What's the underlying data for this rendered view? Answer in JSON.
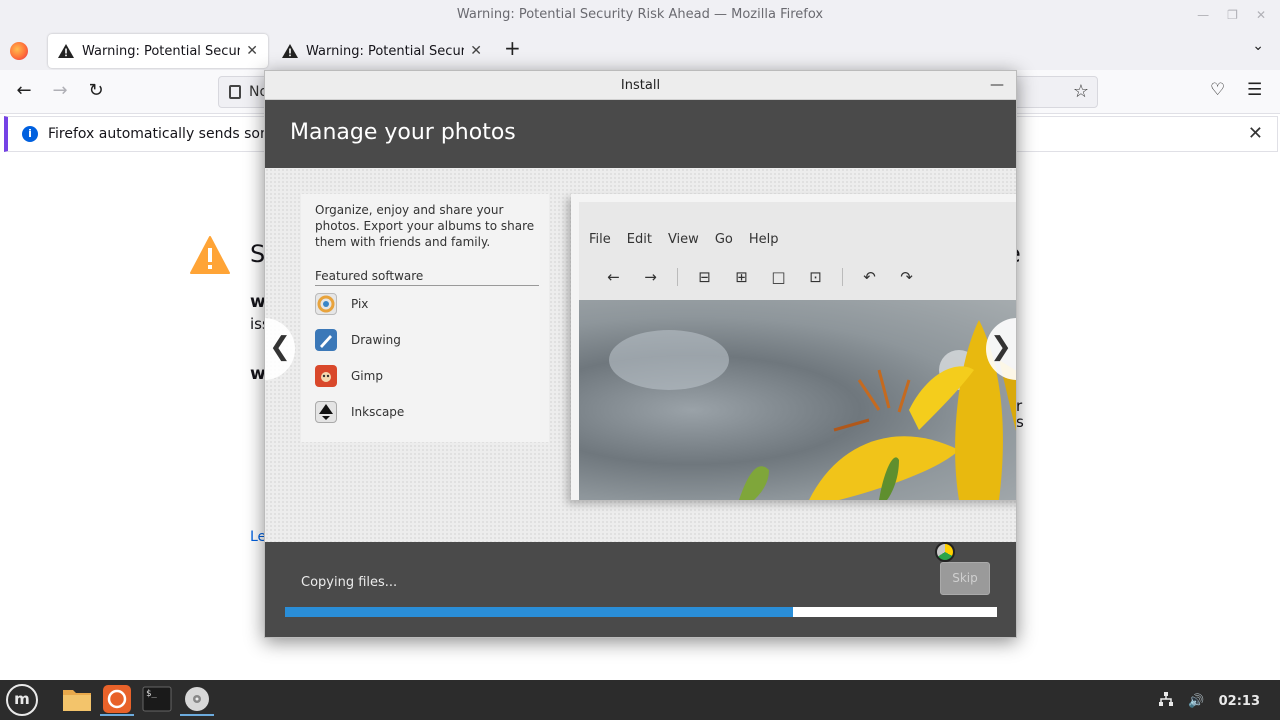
{
  "window": {
    "title": "Warning: Potential Security Risk Ahead — Mozilla Firefox"
  },
  "tabs": [
    {
      "label": "Warning: Potential Security Risk Ahead",
      "active": true
    },
    {
      "label": "Warning: Potential Security Risk Ahead",
      "active": false
    }
  ],
  "urlbar": {
    "text_visible": "No"
  },
  "notification": {
    "text": "Firefox automatically sends some da"
  },
  "page": {
    "fragments": [
      "S",
      "e",
      "w",
      "iss",
      "w",
      "r",
      "s",
      "Le"
    ]
  },
  "installer": {
    "window_title": "Install",
    "slide_title": "Manage your photos",
    "description": "Organize, enjoy and share your photos. Export your albums to share them with friends and family.",
    "featured_label": "Featured software",
    "apps": [
      {
        "name": "Pix",
        "icon": "pix-icon"
      },
      {
        "name": "Drawing",
        "icon": "drawing-icon"
      },
      {
        "name": "Gimp",
        "icon": "gimp-icon"
      },
      {
        "name": "Inkscape",
        "icon": "inkscape-icon"
      }
    ],
    "screenshot_menu": [
      "File",
      "Edit",
      "View",
      "Go",
      "Help"
    ],
    "status_text": "Copying files...",
    "skip_label": "Skip",
    "progress": 0.714
  },
  "taskbar": {
    "clock": "02:13"
  },
  "colors": {
    "accent": "#2a8ed8",
    "installer_dark": "#4a4a4a",
    "notification_accent": "#7542e5"
  }
}
